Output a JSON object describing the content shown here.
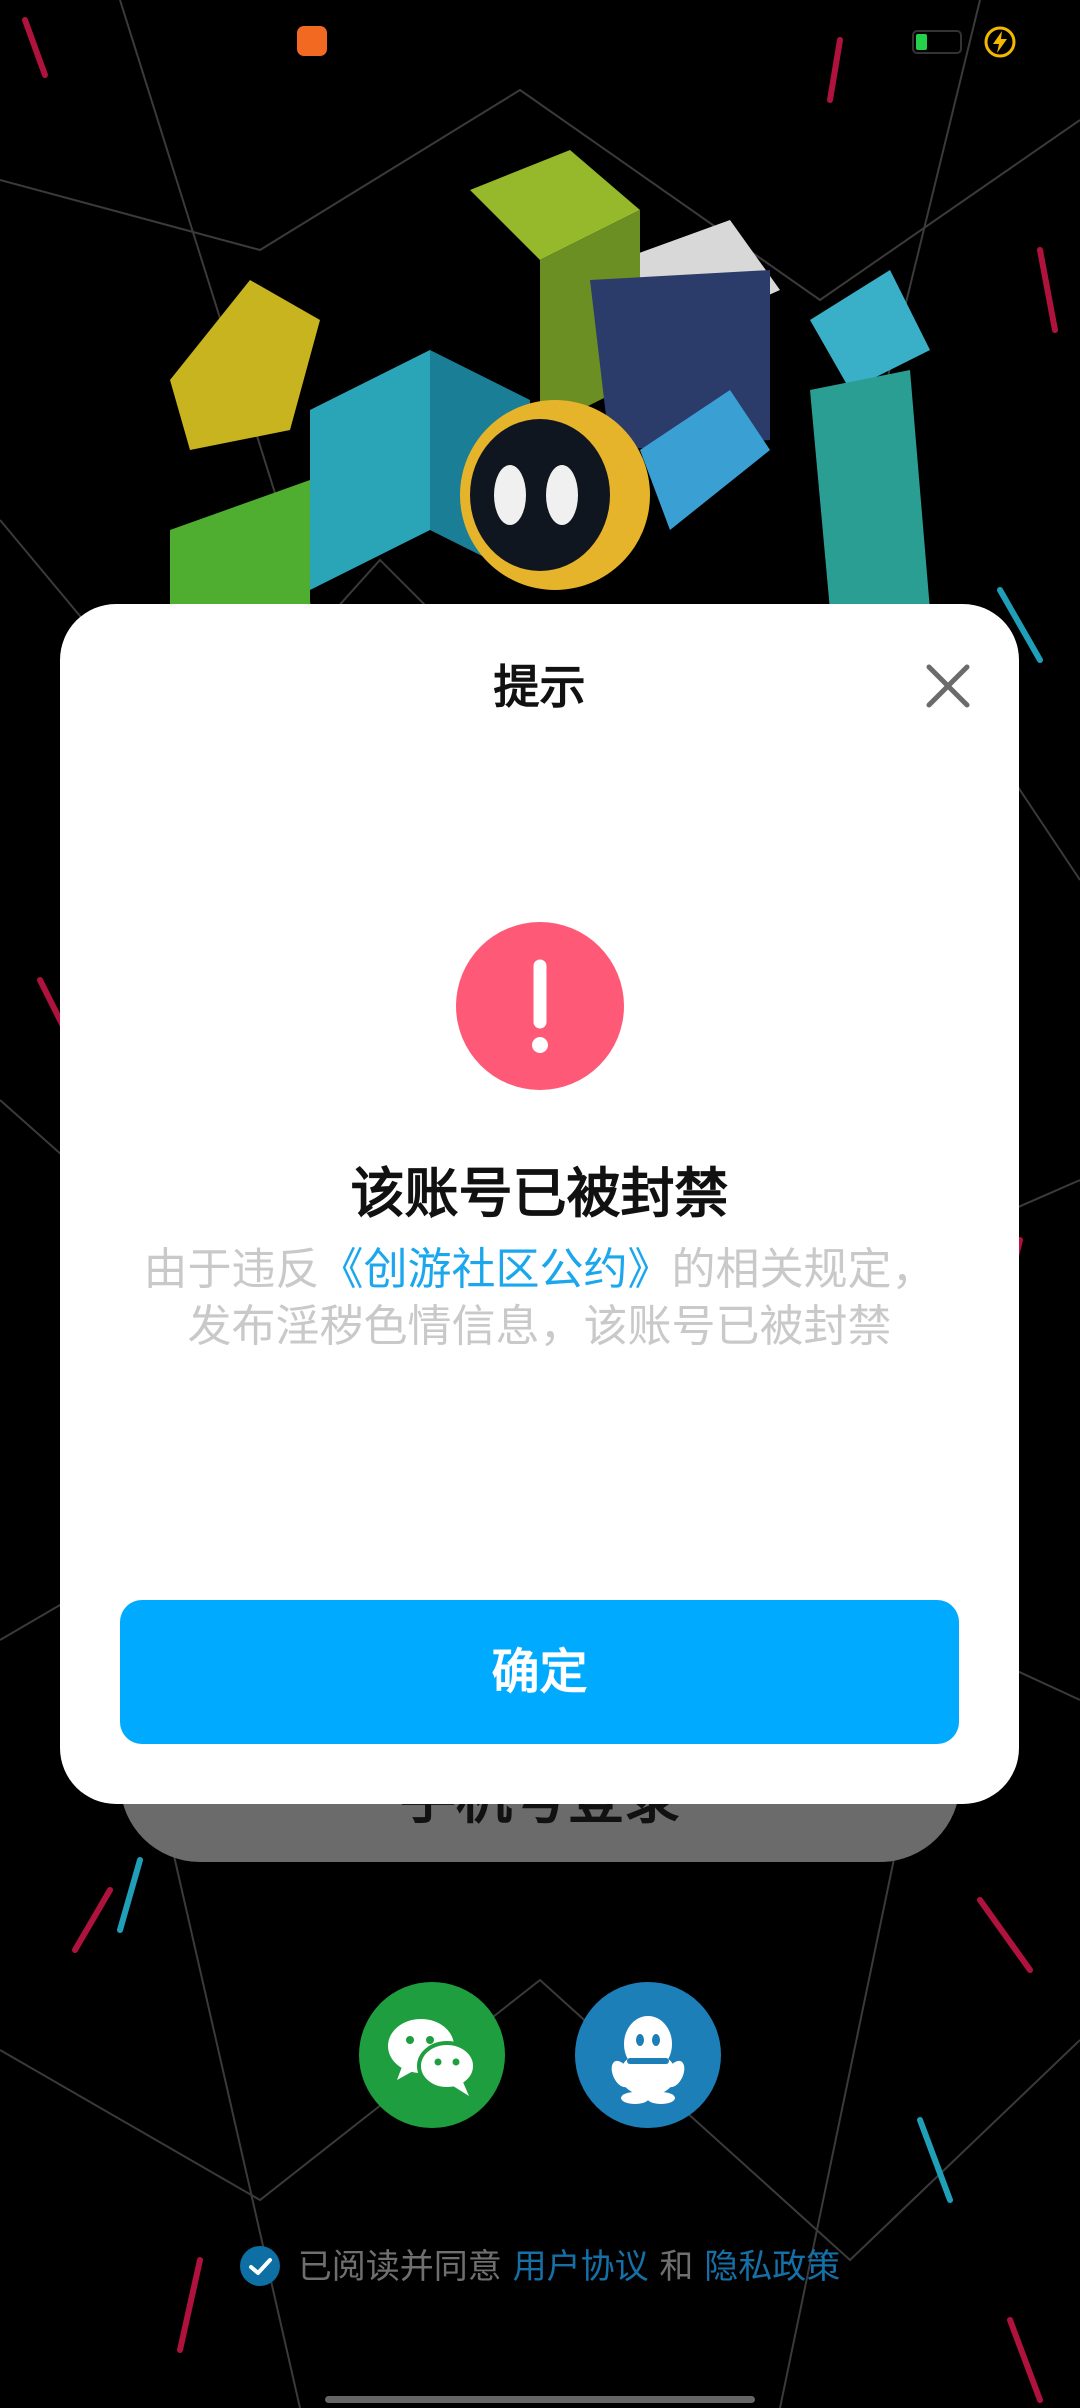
{
  "status_bar": {
    "app_icon": "app-notification-icon",
    "battery_icon": "battery-icon",
    "charging_icon": "charging-bolt-icon",
    "battery_color": "#25d04a"
  },
  "background": {
    "art": "isometric-pixel-game-art"
  },
  "login": {
    "phone_login_label": "手机号登录",
    "wechat_icon": "wechat-icon",
    "qq_icon": "qq-icon",
    "agreement_prefix": "已阅读并同意",
    "user_agreement": "用户协议",
    "agreement_and": "和",
    "privacy_policy": "隐私政策"
  },
  "dialog": {
    "title": "提示",
    "heading": "该账号已被封禁",
    "message_before": "由于违反",
    "rule_link": "《创游社区公约》",
    "message_after": "的相关规定，发布淫秽色情信息，该账号已被封禁",
    "confirm_label": "确定",
    "alert_icon": "exclamation-icon",
    "alert_color": "#fe5a78",
    "accent_color": "#00aaff"
  }
}
